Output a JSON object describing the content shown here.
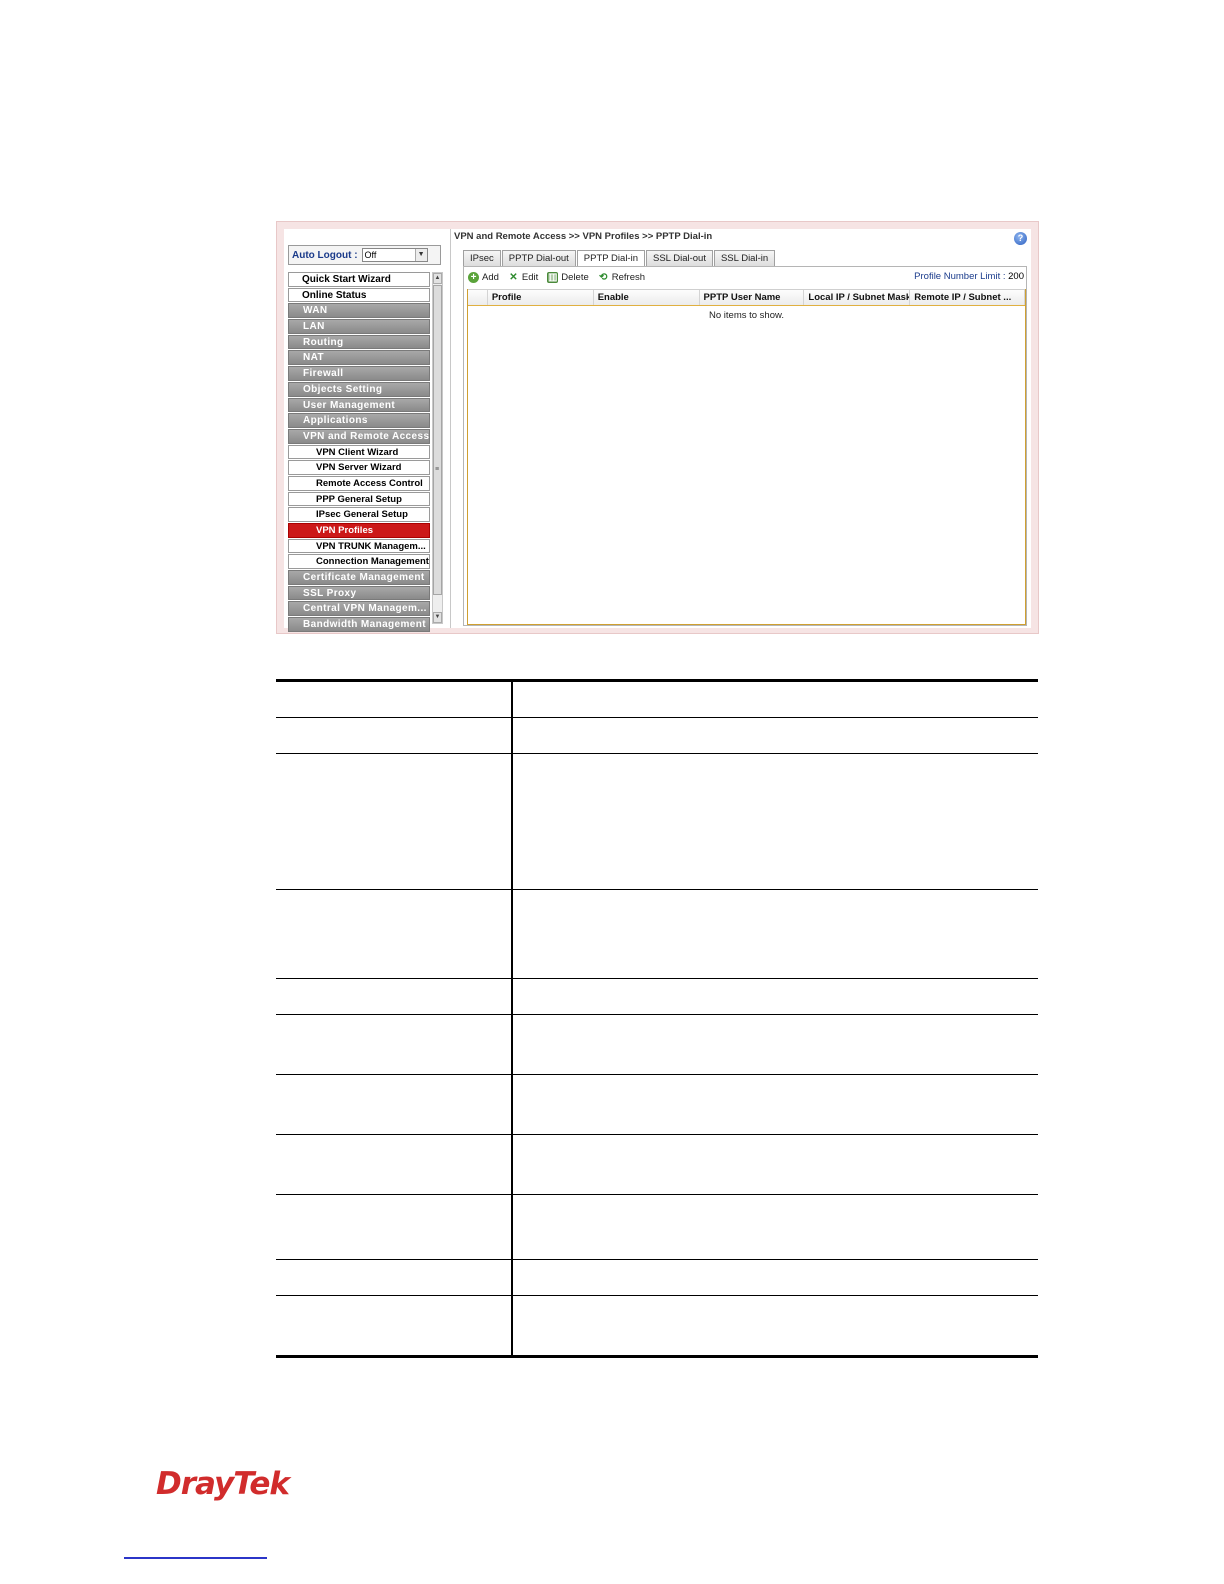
{
  "breadcrumb": "VPN and Remote Access >> VPN Profiles >> PPTP Dial-in",
  "help_icon": "?",
  "auto_logout": {
    "label": "Auto Logout :",
    "value": "Off"
  },
  "menu": [
    {
      "label": "Quick Start Wizard",
      "style": "top"
    },
    {
      "label": "Online Status",
      "style": "top"
    },
    {
      "label": "WAN",
      "style": "grey"
    },
    {
      "label": "LAN",
      "style": "grey"
    },
    {
      "label": "Routing",
      "style": "grey"
    },
    {
      "label": "NAT",
      "style": "grey"
    },
    {
      "label": "Firewall",
      "style": "grey"
    },
    {
      "label": "Objects Setting",
      "style": "grey"
    },
    {
      "label": "User Management",
      "style": "grey"
    },
    {
      "label": "Applications",
      "style": "grey"
    },
    {
      "label": "VPN and Remote Access",
      "style": "grey"
    },
    {
      "label": "VPN Client Wizard",
      "style": "sub"
    },
    {
      "label": "VPN Server Wizard",
      "style": "sub"
    },
    {
      "label": "Remote Access Control",
      "style": "sub"
    },
    {
      "label": "PPP General Setup",
      "style": "sub"
    },
    {
      "label": "IPsec General Setup",
      "style": "sub"
    },
    {
      "label": "VPN Profiles",
      "style": "sub active"
    },
    {
      "label": "VPN TRUNK Managem...",
      "style": "sub"
    },
    {
      "label": "Connection Management",
      "style": "sub"
    },
    {
      "label": "Certificate Management",
      "style": "grey"
    },
    {
      "label": "SSL Proxy",
      "style": "grey"
    },
    {
      "label": "Central VPN Managem...",
      "style": "grey"
    },
    {
      "label": "Bandwidth Management",
      "style": "grey"
    }
  ],
  "tabs": [
    {
      "label": "IPsec",
      "active": false
    },
    {
      "label": "PPTP Dial-out",
      "active": false
    },
    {
      "label": "PPTP Dial-in",
      "active": true
    },
    {
      "label": "SSL Dial-out",
      "active": false
    },
    {
      "label": "SSL Dial-in",
      "active": false
    }
  ],
  "toolbar": {
    "add": "Add",
    "edit": "Edit",
    "delete": "Delete",
    "refresh": "Refresh"
  },
  "profile_limit": {
    "label": "Profile Number Limit :",
    "value": "200"
  },
  "columns": [
    "",
    "Profile",
    "Enable",
    "PPTP User Name",
    "Local IP / Subnet Mask",
    "Remote IP / Subnet ..."
  ],
  "empty_message": "No items to show.",
  "logo": "DrayTek",
  "colors": {
    "active_menu": "#cc1818",
    "logo": "#d12c2c"
  }
}
